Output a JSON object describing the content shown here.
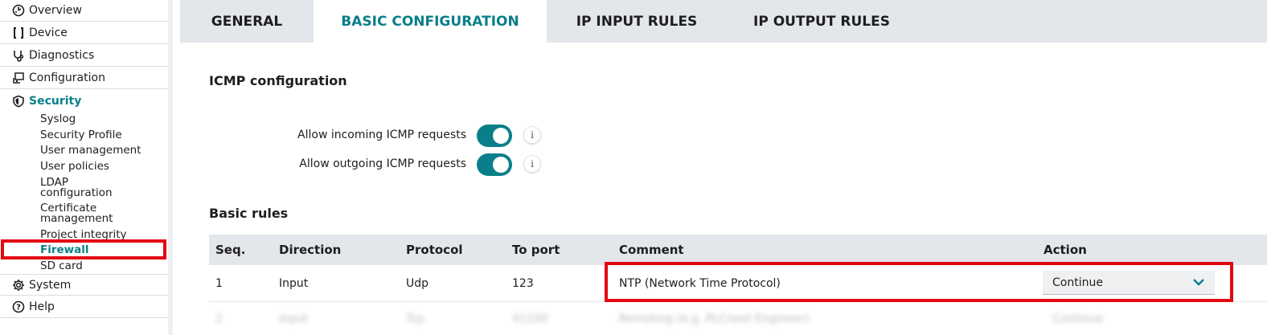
{
  "sidebar": {
    "items": [
      {
        "label": "Overview",
        "icon": "overview-icon"
      },
      {
        "label": "Device",
        "icon": "device-icon"
      },
      {
        "label": "Diagnostics",
        "icon": "stethoscope-icon"
      },
      {
        "label": "Configuration",
        "icon": "configuration-icon"
      },
      {
        "label": "Security",
        "icon": "shield-icon"
      },
      {
        "label": "System",
        "icon": "gear-icon"
      },
      {
        "label": "Help",
        "icon": "help-icon"
      }
    ],
    "security_sub": [
      "Syslog",
      "Security Profile",
      "User management",
      "User policies",
      "LDAP",
      "configuration",
      "Certificate",
      "management",
      "Project integrity",
      "Firewall",
      "SD card"
    ]
  },
  "tabs": [
    "GENERAL",
    "BASIC CONFIGURATION",
    "IP INPUT RULES",
    "IP OUTPUT RULES"
  ],
  "active_tab": "BASIC CONFIGURATION",
  "icmp": {
    "title": "ICMP configuration",
    "incoming_label": "Allow incoming ICMP requests",
    "outgoing_label": "Allow outgoing ICMP requests",
    "incoming_enabled": true,
    "outgoing_enabled": true,
    "info_glyph": "i"
  },
  "rules": {
    "title": "Basic rules",
    "headers": [
      "Seq.",
      "Direction",
      "Protocol",
      "To port",
      "Comment",
      "Action"
    ],
    "row": {
      "seq": "1",
      "direction": "Input",
      "protocol": "Udp",
      "port": "123",
      "comment": "NTP (Network Time Protocol)",
      "action": "Continue"
    },
    "blurred_row": {
      "seq": "2",
      "direction": "Input",
      "protocol": "Tcp",
      "port": "41100",
      "comment": "Remoting (e.g. PLCnext Engineer)",
      "action": "Continue"
    }
  },
  "colors": {
    "accent": "#0a7f8a",
    "highlight": "#e30613",
    "tabbar": "#e3e6ea"
  }
}
